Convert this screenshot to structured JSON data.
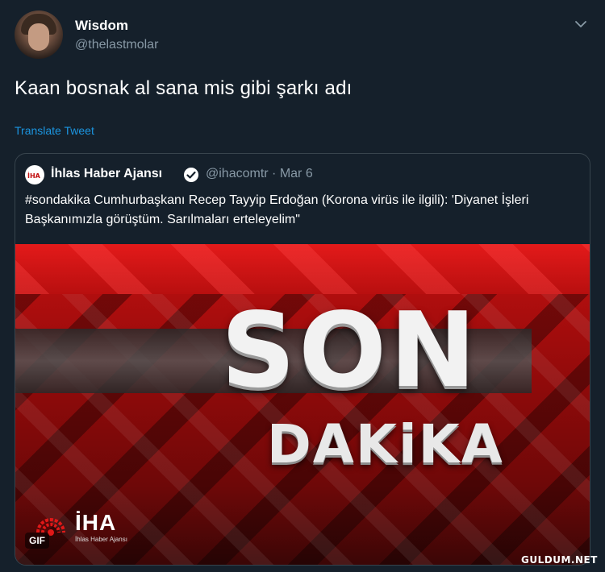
{
  "tweet": {
    "author": {
      "name": "Wisdom",
      "handle": "@thelastmolar"
    },
    "text": "Kaan bosnak al sana mis gibi şarkı adı",
    "translate_label": "Translate Tweet",
    "caret_icon": "chevron-down-icon"
  },
  "quoted_tweet": {
    "author": {
      "name": "İhlas Haber Ajansı",
      "handle": "@ihacomtr",
      "separator": "·",
      "date": "Mar 6",
      "verified": true
    },
    "text": "#sondakika Cumhurbaşkanı Recep Tayyip Erdoğan (Korona virüs ile ilgili):  'Diyanet İşleri Başkanımızla görüştüm. Sarılmaları erteleyelim\"",
    "media": {
      "type": "GIF",
      "gif_badge": "GIF",
      "headline_top": "SON",
      "headline_bottom": "DAKiKA",
      "logo_text": "İHA",
      "logo_subtext": "İhlas Haber Ajansı"
    }
  },
  "watermark": "GULDUM.NET",
  "colors": {
    "background": "#15202b",
    "secondary_text": "#8899a6",
    "link": "#1b95e0",
    "border": "#38444d",
    "media_red": "#c21010"
  }
}
